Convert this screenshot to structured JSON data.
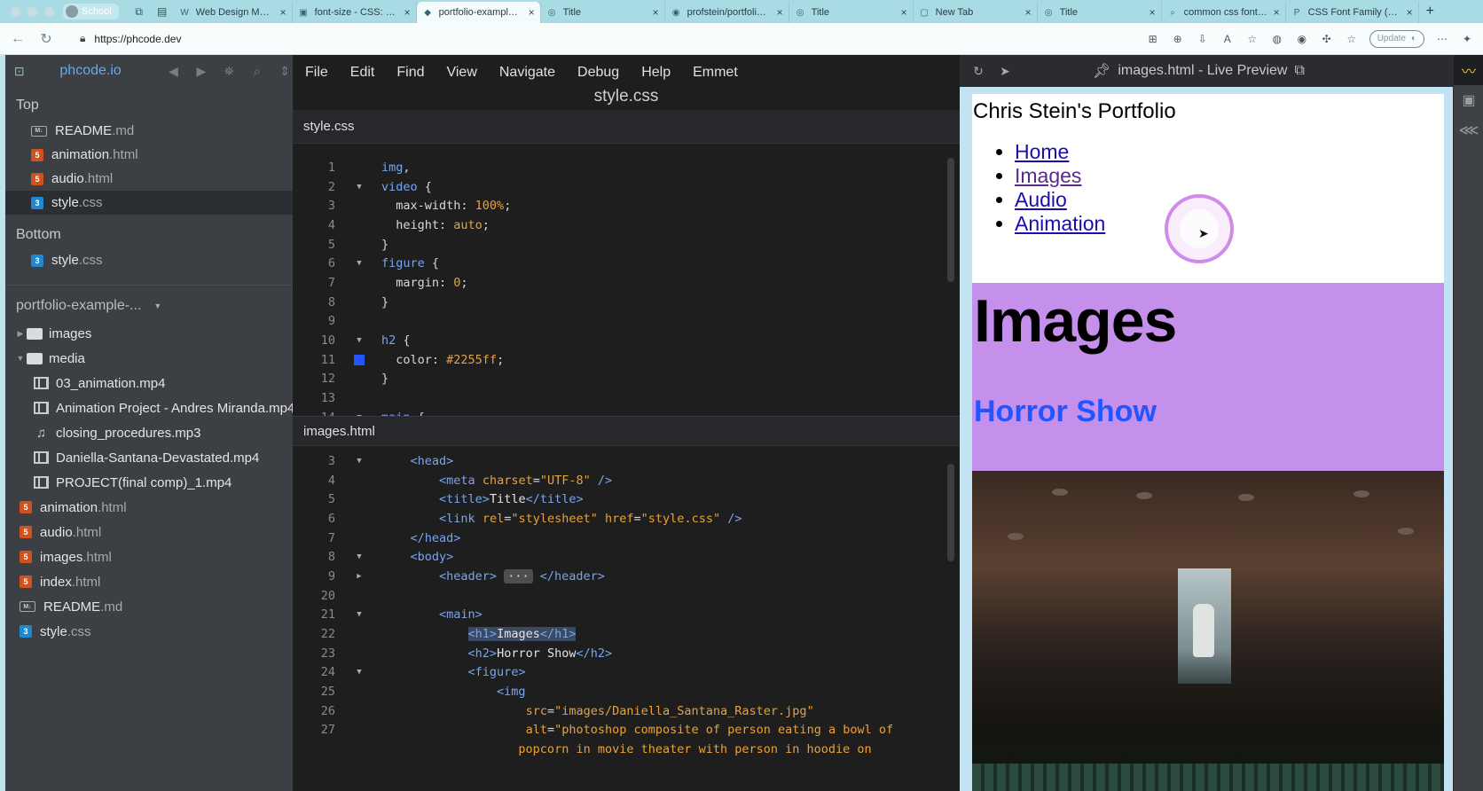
{
  "browser": {
    "profile_label": "School",
    "tabs": [
      {
        "title": "Web Design Module",
        "icon": "W"
      },
      {
        "title": "font-size - CSS: Cascading",
        "icon": "▣"
      },
      {
        "title": "portfolio-example-main",
        "icon": "◆",
        "active": true
      },
      {
        "title": "Title",
        "icon": "◎"
      },
      {
        "title": "profstein/portfolio-example",
        "icon": "◉"
      },
      {
        "title": "Title",
        "icon": "◎"
      },
      {
        "title": "New Tab",
        "icon": "▢"
      },
      {
        "title": "Title",
        "icon": "◎"
      },
      {
        "title": "common css font families",
        "icon": "⌕"
      },
      {
        "title": "CSS Font Family (With Examples)",
        "icon": "P"
      }
    ],
    "url": "https://phcode.dev",
    "update_label": "Update"
  },
  "sidebar": {
    "brand": "phcode.io",
    "working_files_top_title": "Top",
    "working_files_top": [
      {
        "name": "README",
        "ext": ".md",
        "type": "md"
      },
      {
        "name": "animation",
        "ext": ".html",
        "type": "html"
      },
      {
        "name": "audio",
        "ext": ".html",
        "type": "html"
      },
      {
        "name": "style",
        "ext": ".css",
        "type": "css",
        "selected": true
      }
    ],
    "working_files_bottom_title": "Bottom",
    "working_files_bottom": [
      {
        "name": "style",
        "ext": ".css",
        "type": "css"
      }
    ],
    "project_name": "portfolio-example-...",
    "tree": [
      {
        "name": "images",
        "kind": "folder",
        "level": 0,
        "twisty": "▶"
      },
      {
        "name": "media",
        "kind": "folder",
        "level": 0,
        "twisty": "▼"
      },
      {
        "name": "03_animation.mp4",
        "kind": "video",
        "level": 1
      },
      {
        "name": "Animation Project - Andres Miranda.mp4",
        "kind": "video",
        "level": 1
      },
      {
        "name": "closing_procedures.mp3",
        "kind": "audio",
        "level": 1
      },
      {
        "name": "Daniella-Santana-Devastated.mp4",
        "kind": "video",
        "level": 1
      },
      {
        "name": "PROJECT(final comp)_1.mp4",
        "kind": "video",
        "level": 1
      },
      {
        "name": "animation",
        "ext": ".html",
        "kind": "html",
        "level": 0
      },
      {
        "name": "audio",
        "ext": ".html",
        "kind": "html",
        "level": 0
      },
      {
        "name": "images",
        "ext": ".html",
        "kind": "html",
        "level": 0
      },
      {
        "name": "index",
        "ext": ".html",
        "kind": "html",
        "level": 0
      },
      {
        "name": "README",
        "ext": ".md",
        "kind": "md",
        "level": 0
      },
      {
        "name": "style",
        "ext": ".css",
        "kind": "css",
        "level": 0
      }
    ]
  },
  "editor": {
    "menu": [
      "File",
      "Edit",
      "Find",
      "View",
      "Navigate",
      "Debug",
      "Help",
      "Emmet"
    ],
    "doc_title": "style.css",
    "top_pane_title": "style.css",
    "bottom_pane_title": "images.html"
  },
  "preview": {
    "title": "images.html - Live Preview",
    "site_title": "Chris Stein's Portfolio",
    "nav": [
      "Home",
      "Images",
      "Audio",
      "Animation"
    ],
    "h1": "Images",
    "h2": "Horror Show",
    "h2_color": "#2255ff",
    "main_bg": "#c490ec"
  }
}
